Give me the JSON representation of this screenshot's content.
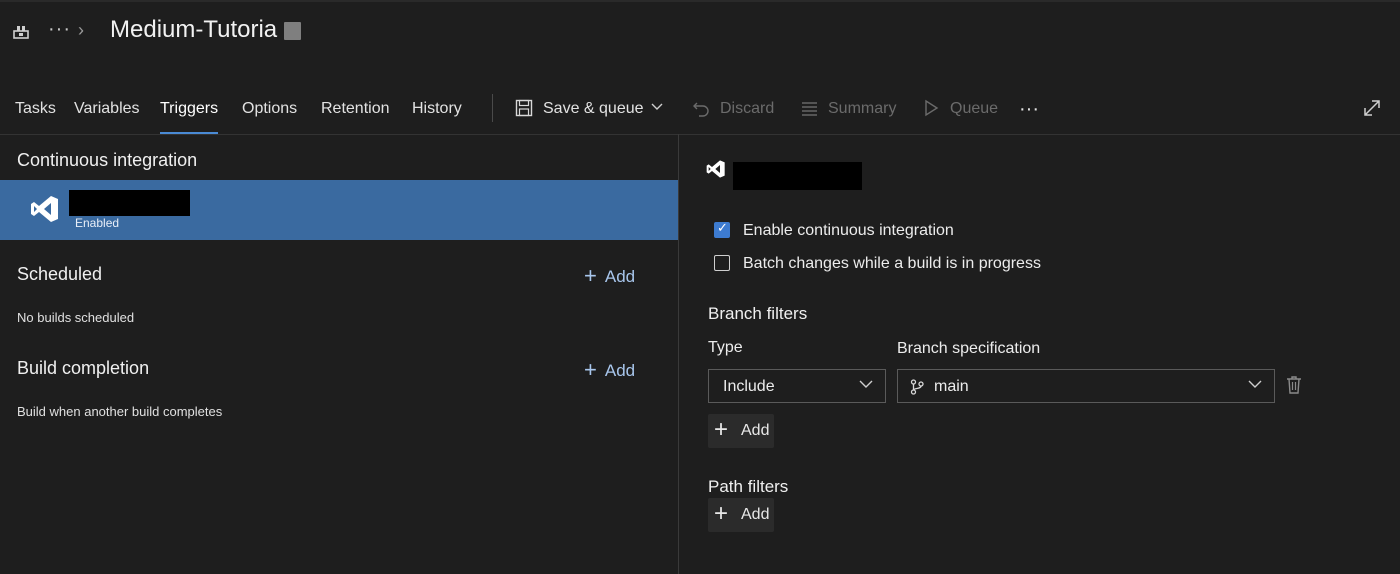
{
  "header": {
    "title": "Medium-Tutoria",
    "more": "···"
  },
  "tabs": [
    {
      "label": "Tasks",
      "active": false
    },
    {
      "label": "Variables",
      "active": false
    },
    {
      "label": "Triggers",
      "active": true
    },
    {
      "label": "Options",
      "active": false
    },
    {
      "label": "Retention",
      "active": false
    },
    {
      "label": "History",
      "active": false
    }
  ],
  "toolbar": {
    "save_queue": "Save & queue",
    "discard": "Discard",
    "summary": "Summary",
    "queue": "Queue",
    "more": "···"
  },
  "left": {
    "ci_title": "Continuous integration",
    "ci_item_status": "Enabled",
    "scheduled_title": "Scheduled",
    "scheduled_add": "Add",
    "scheduled_empty": "No builds scheduled",
    "completion_title": "Build completion",
    "completion_add": "Add",
    "completion_desc": "Build when another build completes"
  },
  "right": {
    "enable_ci_label": "Enable continuous integration",
    "enable_ci_checked": true,
    "batch_label": "Batch changes while a build is in progress",
    "batch_checked": false,
    "branch_filters_title": "Branch filters",
    "type_label": "Type",
    "type_value": "Include",
    "branch_spec_label": "Branch specification",
    "branch_spec_value": "main",
    "branch_add": "Add",
    "path_filters_title": "Path filters",
    "path_add": "Add"
  },
  "colors": {
    "background": "#1e1e1e",
    "selected_row": "#3a6aa0",
    "accent": "#4a8ad4",
    "checkbox_checked": "#3d7bd0",
    "link": "#a8c6ec"
  }
}
